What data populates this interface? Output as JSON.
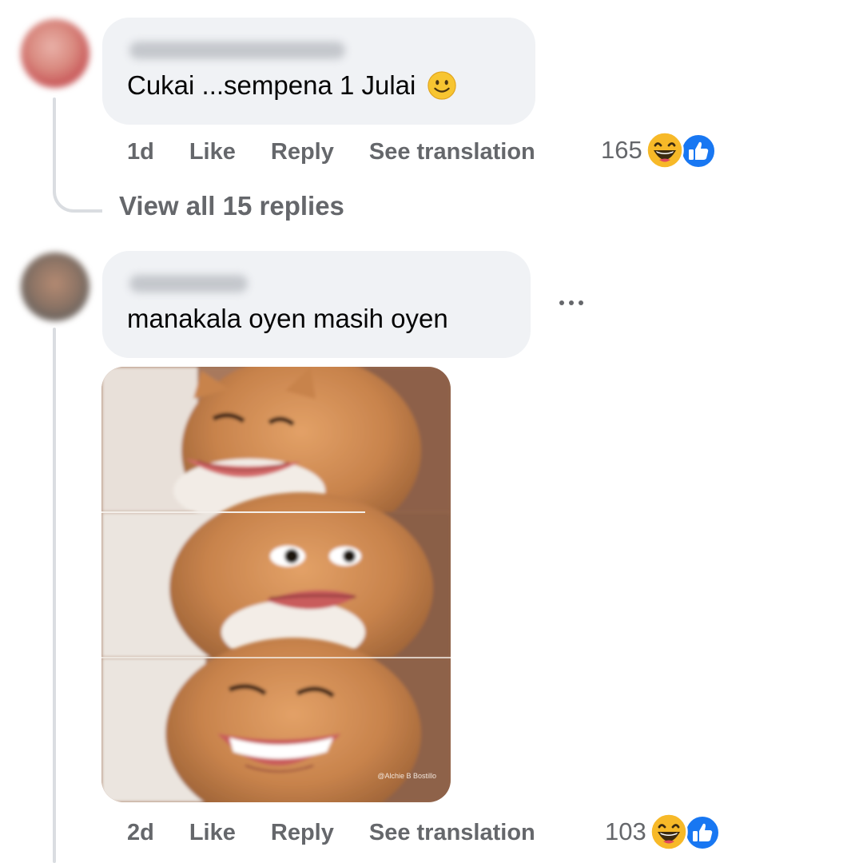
{
  "comments": [
    {
      "text": "Cukai ...sempena 1 Julai",
      "time": "1d",
      "like_label": "Like",
      "reply_label": "Reply",
      "translate_label": "See translation",
      "reaction_count": "165",
      "reactions": [
        "haha-icon",
        "like-icon"
      ],
      "view_replies_label": "View all 15 replies"
    },
    {
      "text": "manakala oyen masih oyen",
      "time": "2d",
      "like_label": "Like",
      "reply_label": "Reply",
      "translate_label": "See translation",
      "reaction_count": "103",
      "reactions": [
        "haha-icon",
        "like-icon"
      ],
      "more_icon": "more-options-icon",
      "image_alt": "Three-panel meme of a ginger cat with an exaggerated human mouth",
      "image_watermark": "@Alchie B Bostillo"
    }
  ],
  "colors": {
    "bubble": "#f0f2f5",
    "secondary_text": "#65676b",
    "like_blue": "#1877f2",
    "haha_yellow": "#f7b928"
  }
}
